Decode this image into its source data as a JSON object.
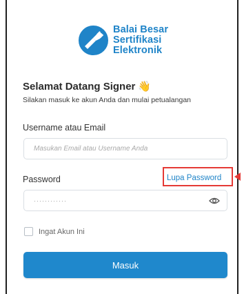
{
  "brand": {
    "lines": [
      "Balai Besar",
      "Sertifikasi",
      "Elektronik"
    ],
    "color": "#1f84c8",
    "icon": "shield-plug-logo"
  },
  "welcome": {
    "title": "Selamat Datang Signer",
    "emoji": "👋",
    "subtitle": "Silakan masuk ke akun Anda dan mulai petualangan"
  },
  "form": {
    "username_label": "Username atau Email",
    "username_placeholder": "Masukan Email atau Username Anda",
    "password_label": "Password",
    "forgot_link": "Lupa Password",
    "password_value_masked": "············",
    "password_icon": "eye-icon",
    "remember_label": "Ingat Akun Ini",
    "remember_checked": false,
    "submit_label": "Masuk"
  },
  "colors": {
    "accent": "#1f88cc",
    "highlight": "#e53935"
  }
}
